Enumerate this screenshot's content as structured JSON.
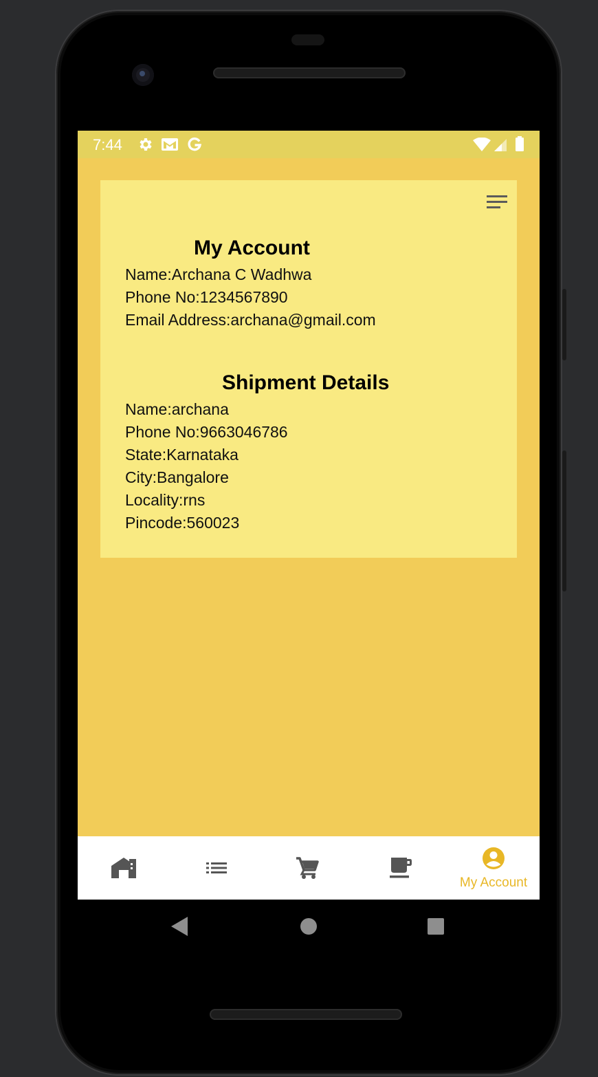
{
  "status_bar": {
    "time": "7:44",
    "icons": [
      "gear-icon",
      "mail-icon",
      "google-icon",
      "wifi-icon",
      "signal-icon",
      "battery-icon"
    ]
  },
  "account": {
    "title": "My Account",
    "name": "Name:Archana C Wadhwa",
    "phone": "Phone No:1234567890",
    "email": "Email Address:archana@gmail.com"
  },
  "shipment": {
    "title": "Shipment Details",
    "name": "Name:archana",
    "phone": "Phone No:9663046786",
    "state": "State:Karnataka",
    "city": "City:Bangalore",
    "locality": "Locality:rns",
    "pincode": "Pincode:560023"
  },
  "bottom_nav": {
    "items": [
      {
        "icon": "home-icon",
        "label": ""
      },
      {
        "icon": "list-icon",
        "label": ""
      },
      {
        "icon": "cart-icon",
        "label": ""
      },
      {
        "icon": "cup-icon",
        "label": ""
      },
      {
        "icon": "account-circle-icon",
        "label": "My Account",
        "active": true
      }
    ]
  },
  "colors": {
    "screen_background": "#f2cc58",
    "card_background": "#f9ea82",
    "status_bar": "#e4d25d",
    "active_accent": "#e8b726",
    "inactive_icon": "#555555"
  }
}
